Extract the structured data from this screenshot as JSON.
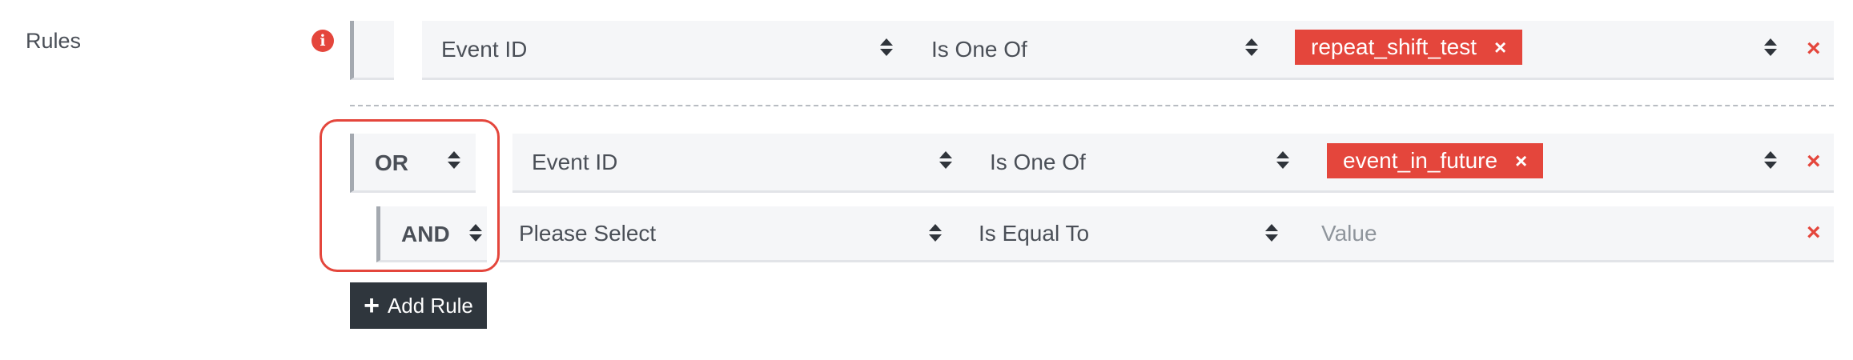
{
  "form": {
    "rules_label": "Rules"
  },
  "group1": {
    "rule1": {
      "field": "Event ID",
      "operator": "Is One Of",
      "values": [
        {
          "label": "repeat_shift_test",
          "remove": "×"
        }
      ],
      "remove": "×"
    }
  },
  "group2": {
    "connector": "OR",
    "rule1": {
      "field": "Event ID",
      "operator": "Is One Of",
      "values": [
        {
          "label": "event_in_future",
          "remove": "×"
        }
      ],
      "remove": "×"
    },
    "subgroup": {
      "connector": "AND",
      "rule1": {
        "field": "Please Select",
        "operator": "Is Equal To",
        "value_placeholder": "Value",
        "remove": "×"
      }
    }
  },
  "add_rule": {
    "icon": "+",
    "label": "Add Rule"
  },
  "colors": {
    "accent": "#e4463c",
    "button": "#2f363d",
    "field_bg": "#f5f6f8"
  }
}
